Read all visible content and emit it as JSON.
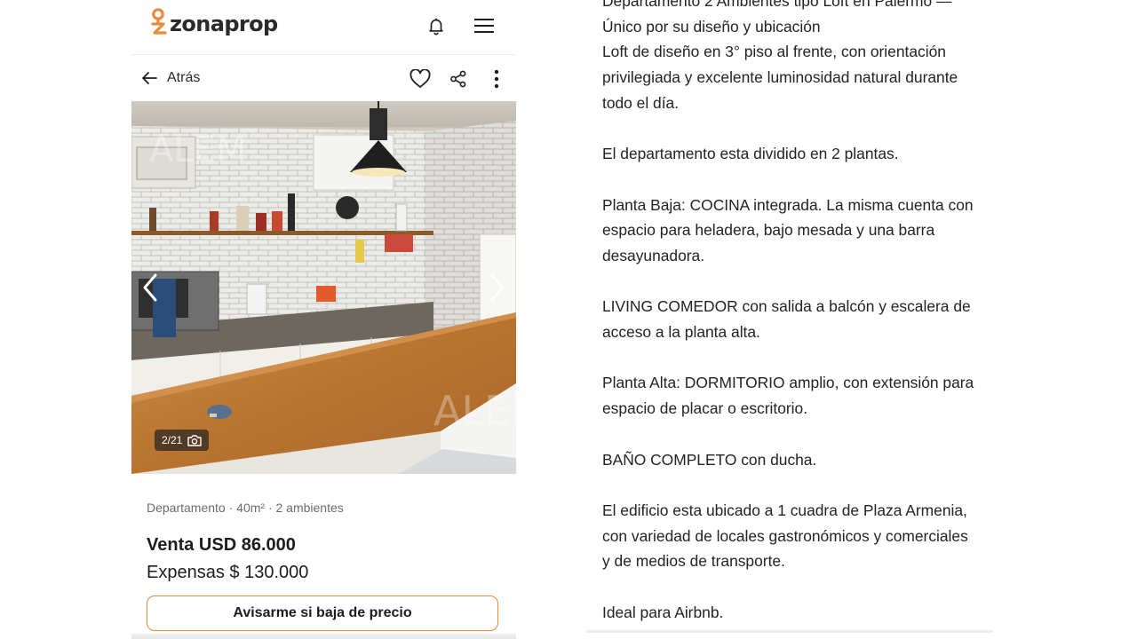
{
  "header": {
    "logo_text": "zonaprop",
    "icons": [
      "zonaprop-pin-icon",
      "bell-icon",
      "hamburger-menu-icon"
    ]
  },
  "nav": {
    "back_label": "Atrás",
    "icons": [
      "arrow-left-icon",
      "heart-icon",
      "share-icon",
      "more-vertical-icon"
    ]
  },
  "gallery": {
    "counter": "2/21",
    "icons": [
      "camera-icon",
      "chevron-left-icon",
      "chevron-right-icon"
    ]
  },
  "listing": {
    "features": "Departamento · 40m² · 2 ambientes",
    "price": "Venta USD 86.000",
    "expensas": "Expensas $ 130.000",
    "alert_button": "Avisarme si baja de precio"
  },
  "description": {
    "paragraphs": [
      "Departamento 2 Ambientes tipo Loft en Palermo —\nÚnico por su diseño y ubicación\nLoft de diseño en 3° piso al frente, con orientación\nprivilegiada y excelente luminosidad natural durante\ntodo el día.",
      "El departamento esta dividido en 2 plantas.",
      "Planta Baja: COCINA integrada. La misma cuenta con\nespacio para heladera, bajo mesada y una barra\ndesayunadora.",
      "LIVING COMEDOR con salida a balcón y escalera de\nacceso a la planta alta.",
      "Planta Alta: DORMITORIO amplio, con extensión para\nespacio de placar o escritorio.",
      "BAÑO COMPLETO con ducha.",
      "El edificio esta ubicado a 1 cuadra de Plaza Armenia,\ncon variedad de locales gastronómicos y comerciales\ny de medios de transporte.",
      "Ideal para Airbnb."
    ]
  },
  "colors": {
    "brand_orange": "#e88a3b",
    "text_dark": "#1d1d1b",
    "text_muted": "#6b6b6b"
  }
}
